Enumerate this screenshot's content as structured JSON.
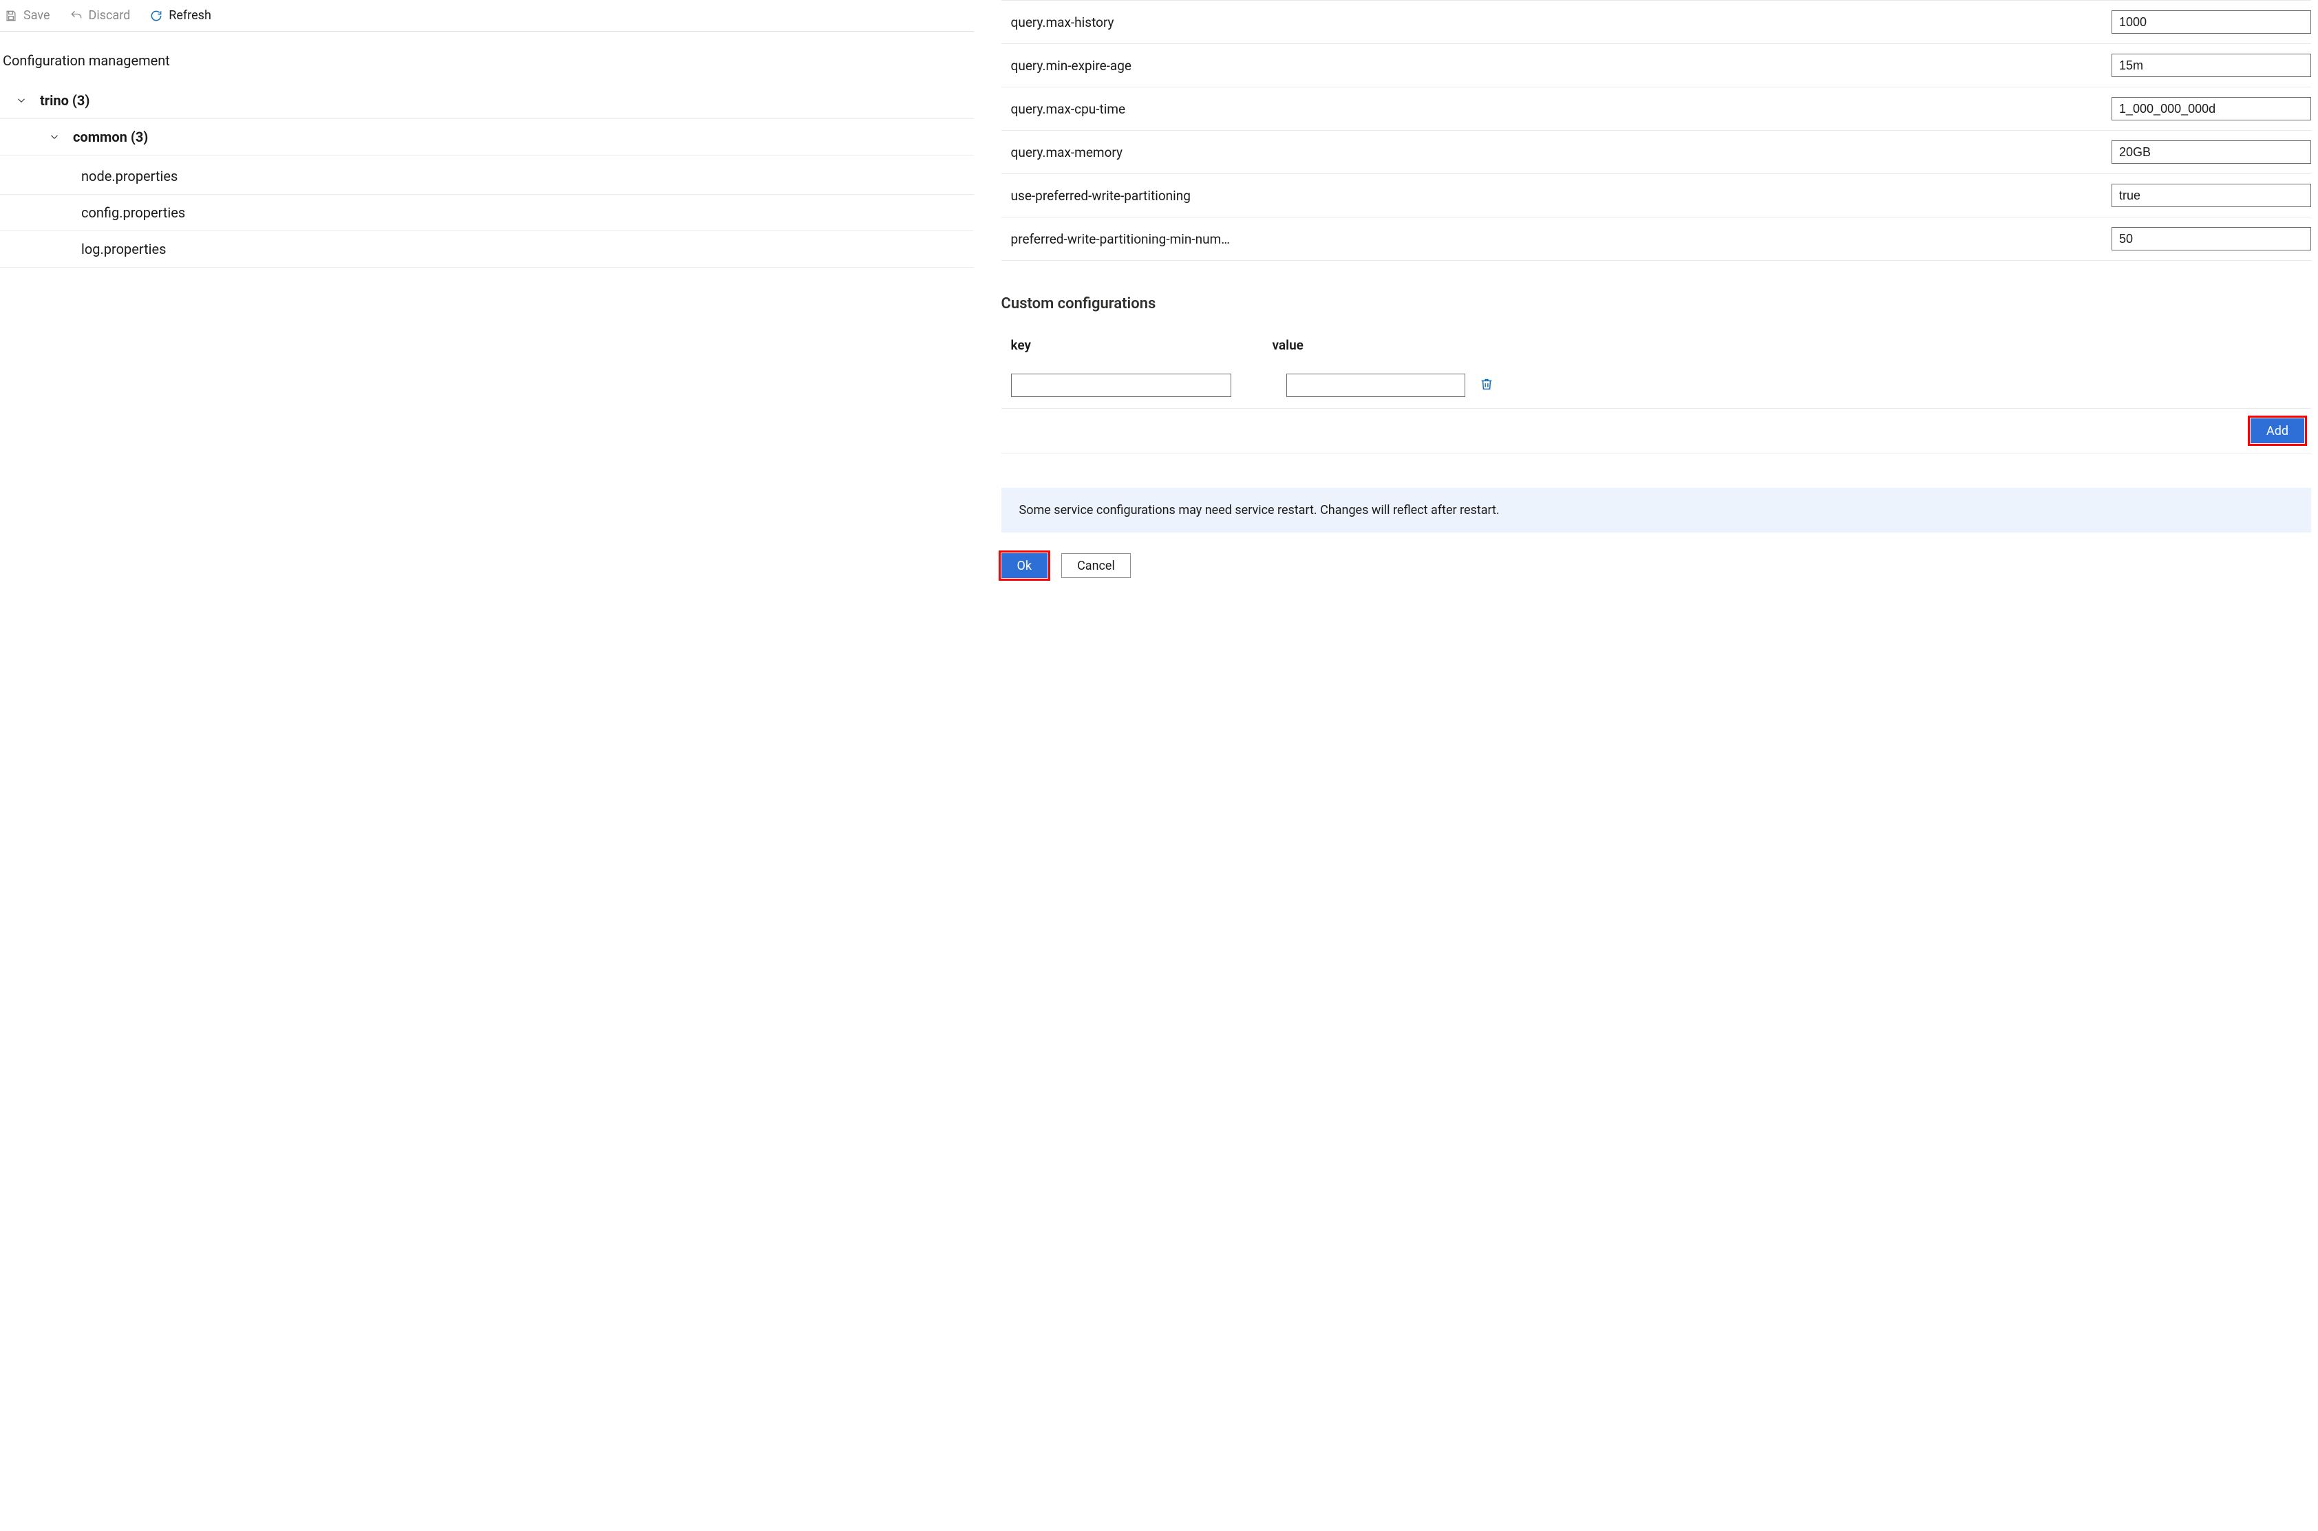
{
  "toolbar": {
    "save": {
      "label": "Save",
      "enabled": false
    },
    "discard": {
      "label": "Discard",
      "enabled": false
    },
    "refresh": {
      "label": "Refresh",
      "enabled": true
    }
  },
  "section_title": "Configuration management",
  "tree": {
    "root": {
      "label": "trino (3)"
    },
    "group": {
      "label": "common (3)"
    },
    "files": [
      {
        "label": "node.properties"
      },
      {
        "label": "config.properties"
      },
      {
        "label": "log.properties"
      }
    ]
  },
  "properties": [
    {
      "key": "query.max-history",
      "value": "1000"
    },
    {
      "key": "query.min-expire-age",
      "value": "15m"
    },
    {
      "key": "query.max-cpu-time",
      "value": "1_000_000_000d"
    },
    {
      "key": "query.max-memory",
      "value": "20GB"
    },
    {
      "key": "use-preferred-write-partitioning",
      "value": "true"
    },
    {
      "key": "preferred-write-partitioning-min-num…",
      "value": "50"
    }
  ],
  "custom": {
    "title": "Custom configurations",
    "headers": {
      "key": "key",
      "value": "value"
    },
    "rows": [
      {
        "key": "",
        "value": ""
      }
    ],
    "add_label": "Add"
  },
  "info_message": "Some service configurations may need service restart. Changes will reflect after restart.",
  "actions": {
    "ok": "Ok",
    "cancel": "Cancel"
  }
}
